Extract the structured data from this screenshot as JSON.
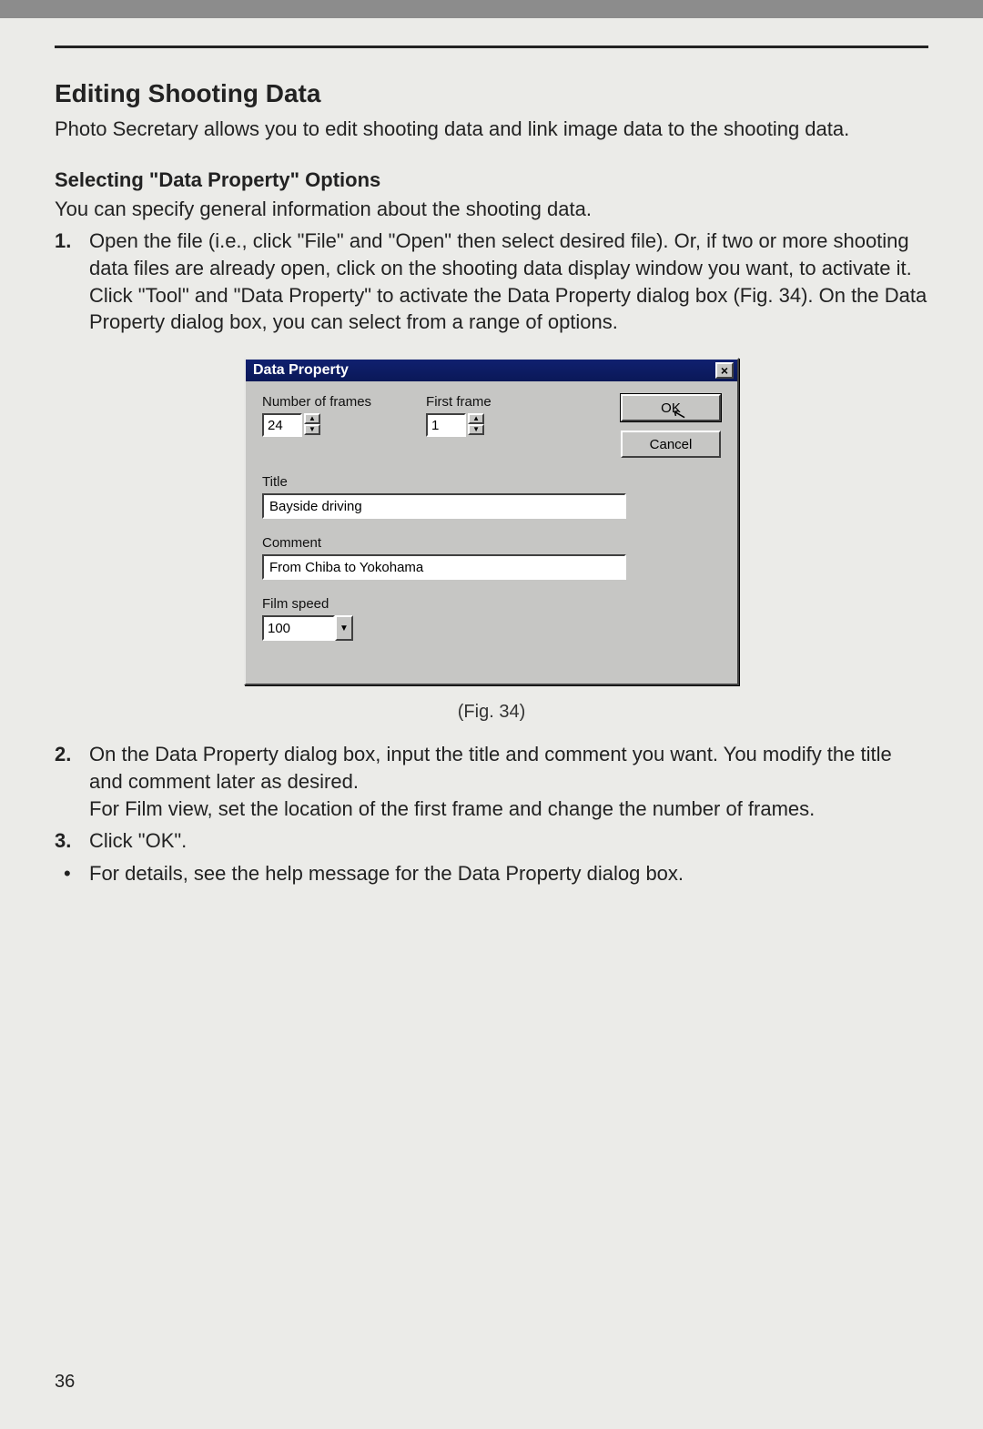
{
  "heading": "Editing Shooting Data",
  "intro": "Photo Secretary allows you to edit shooting data and link image data to the shooting data.",
  "subheading": "Selecting \"Data Property\" Options",
  "sub_intro": "You can specify general information about the shooting data.",
  "steps": {
    "1": "Open the file (i.e., click \"File\" and \"Open\" then select desired file). Or, if two or more shooting data files are already open, click on the shooting data display window you want, to activate it. Click \"Tool\" and \"Data Property\" to activate the Data Property dialog box (Fig. 34). On the Data Property dialog box, you can select from a range of options.",
    "2": "On the Data Property dialog box, input the title and comment you want. You modify the title and comment later as desired.",
    "2b": "For Film view, set the location of the first frame and change the number of frames.",
    "3": "Click \"OK\"."
  },
  "bullet": "For details, see the help message for the Data Property dialog box.",
  "fig_caption": "(Fig. 34)",
  "page_number": "36",
  "dialog": {
    "title": "Data Property",
    "close_glyph": "×",
    "labels": {
      "frames": "Number of frames",
      "first_frame": "First frame",
      "title": "Title",
      "comment": "Comment",
      "film_speed": "Film speed"
    },
    "values": {
      "frames": "24",
      "first_frame": "1",
      "title": "Bayside driving",
      "comment": "From Chiba to Yokohama",
      "film_speed": "100"
    },
    "buttons": {
      "ok": "OK",
      "cancel": "Cancel"
    }
  }
}
